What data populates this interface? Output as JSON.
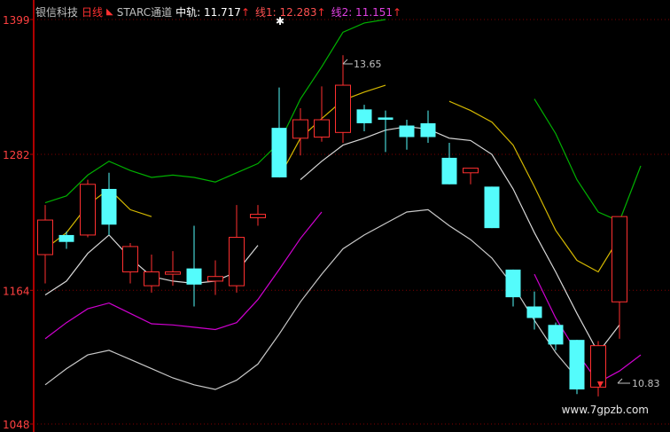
{
  "header": {
    "stock_name": "银信科技",
    "period": "日线",
    "indicator": "STARC通道",
    "mid_label": "中轨: 11.717",
    "line1_label": "线1: 12.283",
    "line2_label": "线2: 11.151",
    "arrow_glyph": "↑"
  },
  "colors": {
    "up": "#ff3030",
    "down": "#54fcfc",
    "mid": "#d8d8d8",
    "upper1": "#d4b800",
    "upper2": "#00b000",
    "lower1": "#d000d0",
    "lower2": "#c8c8c8",
    "axis": "#b00000",
    "grid": "#800000"
  },
  "y_axis": {
    "ticks": [
      {
        "value": 1399,
        "label": "1399"
      },
      {
        "value": 1282,
        "label": "1282"
      },
      {
        "value": 1164,
        "label": "1164"
      },
      {
        "value": 1048,
        "label": "1048"
      }
    ],
    "range": [
      1048,
      1399
    ]
  },
  "annotations": {
    "high": "13.65",
    "low": "10.83",
    "star": "✱"
  },
  "watermark": "www.7gpzb.com",
  "chart_data": {
    "type": "candlestick",
    "ylim": [
      1048,
      1399
    ],
    "candles": [
      {
        "open": 1195,
        "close": 1225,
        "high": 1238,
        "low": 1170
      },
      {
        "open": 1212,
        "close": 1206,
        "high": 1215,
        "low": 1200
      },
      {
        "open": 1212,
        "close": 1256,
        "high": 1260,
        "low": 1210
      },
      {
        "open": 1252,
        "close": 1221,
        "high": 1266,
        "low": 1212
      },
      {
        "open": 1180,
        "close": 1202,
        "high": 1205,
        "low": 1170
      },
      {
        "open": 1168,
        "close": 1180,
        "high": 1195,
        "low": 1162
      },
      {
        "open": 1178,
        "close": 1180,
        "high": 1198,
        "low": 1168
      },
      {
        "open": 1183,
        "close": 1169,
        "high": 1220,
        "low": 1150
      },
      {
        "open": 1172,
        "close": 1176,
        "high": 1190,
        "low": 1160
      },
      {
        "open": 1168,
        "close": 1210,
        "high": 1238,
        "low": 1162
      },
      {
        "open": 1227,
        "close": 1230,
        "high": 1238,
        "low": 1220
      },
      {
        "open": 1305,
        "close": 1262,
        "high": 1340,
        "low": 1262
      },
      {
        "open": 1296,
        "close": 1312,
        "high": 1322,
        "low": 1281
      },
      {
        "open": 1297,
        "close": 1312,
        "high": 1341,
        "low": 1293
      },
      {
        "open": 1301,
        "close": 1342,
        "high": 1368,
        "low": 1292
      },
      {
        "open": 1321,
        "close": 1309,
        "high": 1325,
        "low": 1302
      },
      {
        "open": 1314,
        "close": 1312,
        "high": 1320,
        "low": 1284
      },
      {
        "open": 1307,
        "close": 1297,
        "high": 1312,
        "low": 1286
      },
      {
        "open": 1309,
        "close": 1297,
        "high": 1320,
        "low": 1292
      },
      {
        "open": 1279,
        "close": 1256,
        "high": 1292,
        "low": 1256
      },
      {
        "open": 1266,
        "close": 1270,
        "high": 1270,
        "low": 1256
      },
      {
        "open": 1254,
        "close": 1218,
        "high": 1254,
        "low": 1218
      },
      {
        "open": 1182,
        "close": 1158,
        "high": 1182,
        "low": 1150
      },
      {
        "open": 1150,
        "close": 1140,
        "high": 1163,
        "low": 1130
      },
      {
        "open": 1134,
        "close": 1117,
        "high": 1136,
        "low": 1112
      },
      {
        "open": 1121,
        "close": 1078,
        "high": 1121,
        "low": 1074
      },
      {
        "open": 1080,
        "close": 1116,
        "high": 1120,
        "low": 1072
      },
      {
        "open": 1154,
        "close": 1228,
        "high": 1228,
        "low": 1122
      }
    ],
    "series": [
      {
        "name": "中轨",
        "color_key": "mid",
        "segments": [
          [
            [
              0,
              1160
            ],
            [
              1,
              1172
            ],
            [
              2,
              1196
            ],
            [
              3,
              1212
            ],
            [
              4,
              1192
            ],
            [
              5,
              1176
            ],
            [
              6,
              1172
            ],
            [
              7,
              1170
            ],
            [
              8,
              1172
            ],
            [
              9,
              1180
            ],
            [
              10,
              1203
            ]
          ],
          [
            [
              12,
              1260
            ],
            [
              13,
              1276
            ],
            [
              14,
              1290
            ],
            [
              15,
              1296
            ],
            [
              16,
              1303
            ],
            [
              17,
              1306
            ],
            [
              18,
              1304
            ],
            [
              19,
              1296
            ],
            [
              20,
              1294
            ],
            [
              21,
              1282
            ],
            [
              22,
              1252
            ],
            [
              23,
              1214
            ],
            [
              24,
              1180
            ],
            [
              25,
              1144
            ],
            [
              26,
              1110
            ],
            [
              27,
              1134
            ]
          ]
        ]
      },
      {
        "name": "线1",
        "color_key": "upper1",
        "segments": [
          [
            [
              0,
              1200
            ],
            [
              1,
              1214
            ],
            [
              2,
              1238
            ],
            [
              3,
              1252
            ],
            [
              4,
              1234
            ],
            [
              5,
              1228
            ]
          ],
          [
            [
              11,
              1262
            ],
            [
              12,
              1296
            ],
            [
              13,
              1313
            ],
            [
              14,
              1329
            ],
            [
              15,
              1336
            ],
            [
              16,
              1342
            ]
          ],
          [
            [
              19,
              1328
            ],
            [
              20,
              1320
            ],
            [
              21,
              1310
            ],
            [
              22,
              1290
            ],
            [
              23,
              1254
            ],
            [
              24,
              1216
            ],
            [
              25,
              1190
            ],
            [
              26,
              1180
            ],
            [
              27,
              1210
            ]
          ]
        ]
      },
      {
        "name": "线2",
        "color_key": "upper2",
        "segments": [
          [
            [
              0,
              1240
            ],
            [
              1,
              1246
            ],
            [
              2,
              1264
            ],
            [
              3,
              1276
            ],
            [
              4,
              1268
            ],
            [
              5,
              1262
            ],
            [
              6,
              1264
            ],
            [
              7,
              1262
            ],
            [
              8,
              1258
            ],
            [
              9,
              1266
            ],
            [
              10,
              1274
            ],
            [
              11,
              1292
            ],
            [
              12,
              1330
            ],
            [
              13,
              1358
            ],
            [
              14,
              1388
            ],
            [
              15,
              1396
            ],
            [
              16,
              1399
            ]
          ],
          [
            [
              23,
              1330
            ],
            [
              24,
              1300
            ],
            [
              25,
              1260
            ],
            [
              26,
              1232
            ],
            [
              27,
              1224
            ],
            [
              28,
              1272
            ]
          ]
        ]
      },
      {
        "name": "下轨1",
        "color_key": "lower1",
        "segments": [
          [
            [
              0,
              1122
            ],
            [
              1,
              1136
            ],
            [
              2,
              1148
            ],
            [
              3,
              1153
            ],
            [
              4,
              1144
            ],
            [
              5,
              1135
            ],
            [
              6,
              1134
            ],
            [
              7,
              1132
            ],
            [
              8,
              1130
            ],
            [
              9,
              1136
            ],
            [
              10,
              1156
            ],
            [
              11,
              1182
            ],
            [
              12,
              1209
            ],
            [
              13,
              1232
            ]
          ],
          [
            [
              23,
              1178
            ],
            [
              24,
              1140
            ],
            [
              25,
              1110
            ],
            [
              26,
              1084
            ],
            [
              27,
              1094
            ],
            [
              28,
              1108
            ]
          ]
        ]
      },
      {
        "name": "下轨2",
        "color_key": "lower2",
        "segments": [
          [
            [
              0,
              1082
            ],
            [
              1,
              1096
            ],
            [
              2,
              1108
            ],
            [
              3,
              1112
            ],
            [
              4,
              1104
            ],
            [
              5,
              1096
            ],
            [
              6,
              1088
            ],
            [
              7,
              1082
            ],
            [
              8,
              1078
            ],
            [
              9,
              1086
            ],
            [
              10,
              1100
            ],
            [
              11,
              1126
            ],
            [
              12,
              1154
            ],
            [
              13,
              1178
            ],
            [
              14,
              1200
            ],
            [
              15,
              1212
            ],
            [
              16,
              1222
            ],
            [
              17,
              1232
            ],
            [
              18,
              1234
            ],
            [
              19,
              1220
            ],
            [
              20,
              1208
            ],
            [
              21,
              1192
            ],
            [
              22,
              1168
            ],
            [
              23,
              1138
            ],
            [
              24,
              1110
            ],
            [
              25,
              1088
            ]
          ]
        ]
      }
    ]
  }
}
